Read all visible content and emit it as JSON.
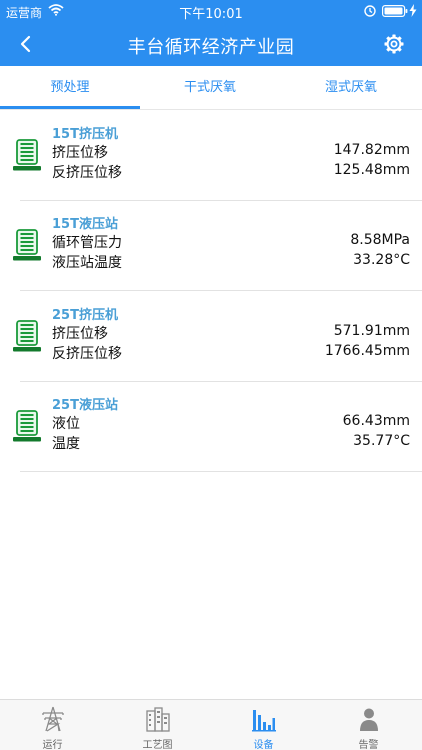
{
  "status_bar": {
    "carrier": "运营商",
    "time": "下午10:01"
  },
  "nav": {
    "title": "丰台循环经济产业园"
  },
  "tabs": [
    {
      "label": "预处理",
      "active": true
    },
    {
      "label": "干式厌氧",
      "active": false
    },
    {
      "label": "湿式厌氧",
      "active": false
    }
  ],
  "devices": [
    {
      "name": "15T挤压机",
      "rows": [
        {
          "label": "挤压位移",
          "value": "147.82mm"
        },
        {
          "label": "反挤压位移",
          "value": "125.48mm"
        }
      ]
    },
    {
      "name": "15T液压站",
      "rows": [
        {
          "label": "循环管压力",
          "value": "8.58MPa"
        },
        {
          "label": "液压站温度",
          "value": "33.28°C"
        }
      ]
    },
    {
      "name": "25T挤压机",
      "rows": [
        {
          "label": "挤压位移",
          "value": "571.91mm"
        },
        {
          "label": "反挤压位移",
          "value": "1766.45mm"
        }
      ]
    },
    {
      "name": "25T液压站",
      "rows": [
        {
          "label": "液位",
          "value": "66.43mm"
        },
        {
          "label": "温度",
          "value": "35.77°C"
        }
      ]
    }
  ],
  "tabbar": [
    {
      "label": "运行",
      "icon": "power-tower-icon",
      "active": false
    },
    {
      "label": "工艺图",
      "icon": "building-icon",
      "active": false
    },
    {
      "label": "设备",
      "icon": "bar-chart-icon",
      "active": true
    },
    {
      "label": "告警",
      "icon": "person-icon",
      "active": false
    }
  ],
  "colors": {
    "accent": "#2b8ef0",
    "device_name": "#4a9fd6",
    "device_icon": "#1a9a3a"
  }
}
